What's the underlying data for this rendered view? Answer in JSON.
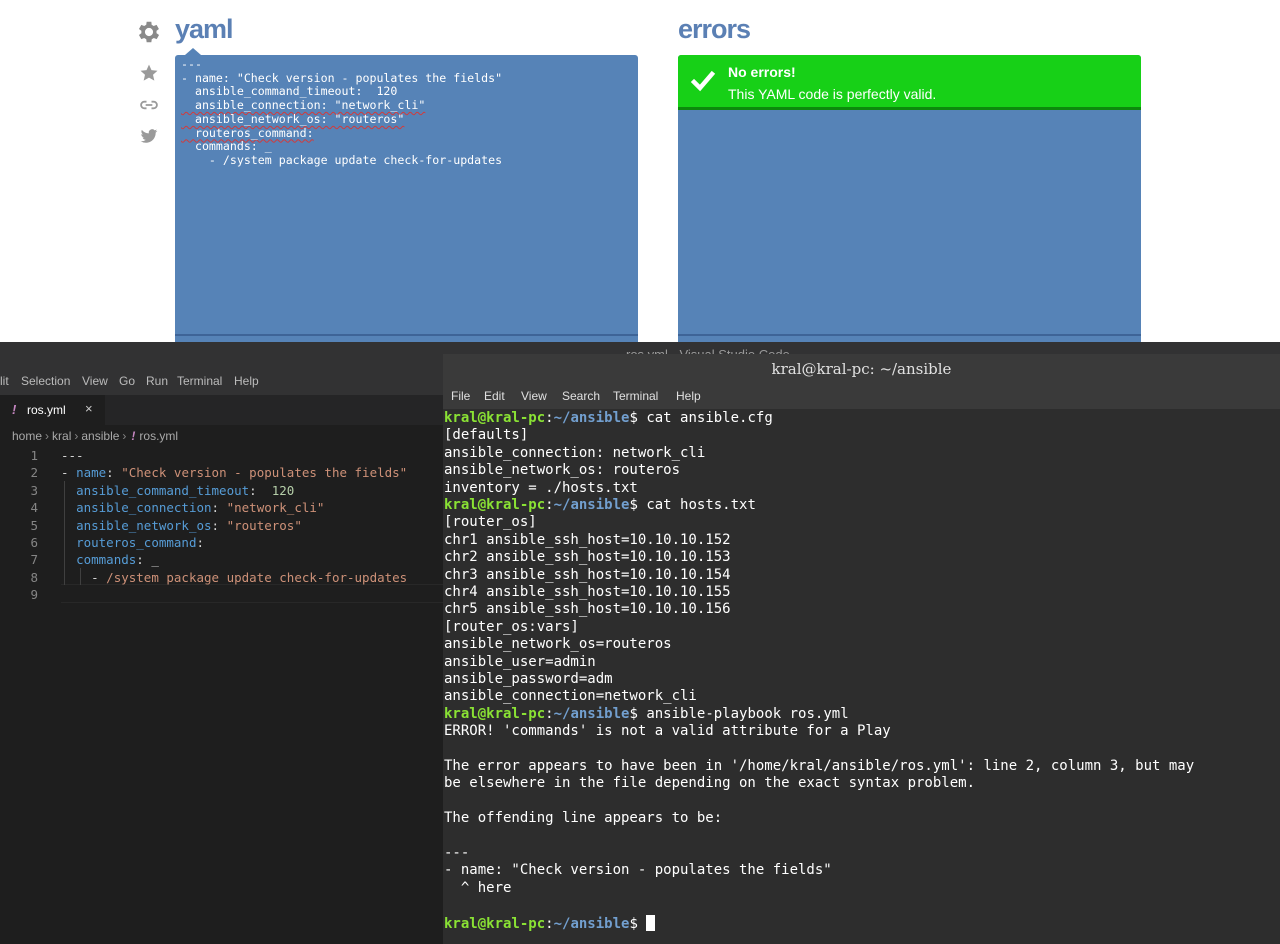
{
  "web": {
    "yaml_title": "yaml",
    "errors_title": "errors",
    "icons": [
      "gear-icon",
      "star-icon",
      "link-icon",
      "twitter-icon"
    ],
    "yaml_lines": [
      "---",
      "- name: \"Check version - populates the fields\"",
      "  ansible_command_timeout:  120",
      "  ansible_connection: \"network_cli\"",
      "  ansible_network_os: \"routeros\"",
      "  routeros_command:",
      "  commands: _",
      "    - /system package update check-for-updates"
    ],
    "status_title": "No errors!",
    "status_message": "This YAML code is perfectly valid.",
    "colors": {
      "panel": "#5683b7",
      "title": "#5b80b4",
      "success": "#17d017"
    }
  },
  "vscode": {
    "window_title": "ros.yml - Visual Studio Code",
    "menu": [
      "lit",
      "Selection",
      "View",
      "Go",
      "Run",
      "Terminal",
      "Help"
    ],
    "tab": {
      "name": "ros.yml",
      "close": "×"
    },
    "breadcrumb": [
      "home",
      "kral",
      "ansible",
      "ros.yml"
    ],
    "line_numbers": [
      "1",
      "2",
      "3",
      "4",
      "5",
      "6",
      "7",
      "8",
      "9"
    ],
    "code": {
      "l1": "---",
      "l2_dash": "- ",
      "l2_key": "name",
      "l2_sep": ": ",
      "l2_val": "\"Check version - populates the fields\"",
      "l3_key": "ansible_command_timeout",
      "l3_sep": ":  ",
      "l3_val": "120",
      "l4_key": "ansible_connection",
      "l4_sep": ": ",
      "l4_val": "\"network_cli\"",
      "l5_key": "ansible_network_os",
      "l5_sep": ": ",
      "l5_val": "\"routeros\"",
      "l6_key": "routeros_command",
      "l6_sep": ":",
      "l7_key": "commands",
      "l7_sep": ": ",
      "l7_val": "_",
      "l8_dash": "- ",
      "l8_val": "/system package update check-for-updates"
    }
  },
  "terminal": {
    "title": "kral@kral-pc: ~/ansible",
    "menu": [
      "File",
      "Edit",
      "View",
      "Search",
      "Terminal",
      "Help"
    ],
    "prompt_user": "kral@kral-pc",
    "prompt_path": "~/ansible",
    "prompt_end": "$",
    "cmd1": "cat ansible.cfg",
    "out1": [
      "[defaults]",
      "ansible_connection: network_cli",
      "ansible_network_os: routeros",
      "inventory = ./hosts.txt"
    ],
    "cmd2": "cat hosts.txt",
    "out2": [
      "[router_os]",
      "chr1 ansible_ssh_host=10.10.10.152",
      "chr2 ansible_ssh_host=10.10.10.153",
      "chr3 ansible_ssh_host=10.10.10.154",
      "chr4 ansible_ssh_host=10.10.10.155",
      "chr5 ansible_ssh_host=10.10.10.156",
      "[router_os:vars]",
      "ansible_network_os=routeros",
      "ansible_user=admin",
      "ansible_password=adm",
      "ansible_connection=network_cli"
    ],
    "cmd3": "ansible-playbook ros.yml",
    "out3": [
      "ERROR! 'commands' is not a valid attribute for a Play",
      "",
      "The error appears to have been in '/home/kral/ansible/ros.yml': line 2, column 3, but may",
      "be elsewhere in the file depending on the exact syntax problem.",
      "",
      "The offending line appears to be:",
      "",
      "---",
      "- name: \"Check version - populates the fields\"",
      "  ^ here",
      ""
    ]
  }
}
